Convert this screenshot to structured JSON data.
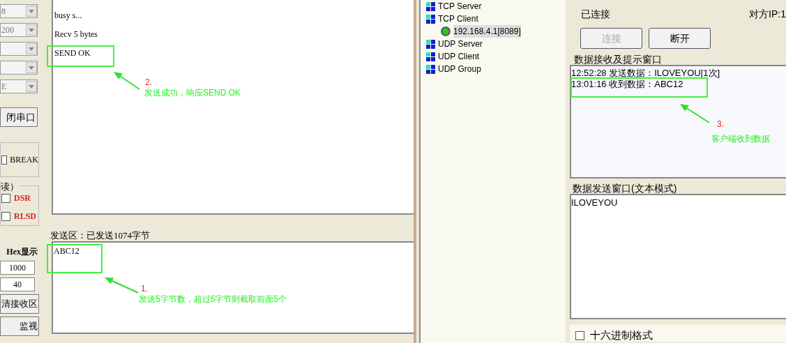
{
  "serial_tool": {
    "left_panel": {
      "combos": [
        {
          "kind": "dropdown",
          "value": "8"
        },
        {
          "kind": "dropdown",
          "value": "200"
        },
        {
          "kind": "dropdown"
        },
        {
          "kind": "dropdown"
        },
        {
          "kind": "dropdown",
          "value": "E"
        }
      ],
      "close_port_button": "闭串口",
      "break_checkbox": {
        "label": "BREAK",
        "checked": false
      },
      "signals_group": {
        "title": "读）",
        "items": [
          {
            "label": "DSR",
            "checked": false
          },
          {
            "label": "RLSD",
            "checked": false
          }
        ]
      },
      "hex_label": "Hex显示",
      "fields": [
        "1000",
        "40"
      ],
      "buttons": [
        "清接收区",
        "监视"
      ]
    },
    "receive_area": {
      "lines": [
        "busy s...",
        "Recv 5 bytes",
        "SEND OK"
      ]
    },
    "send_area": {
      "title": "发送区：已发送1074字节",
      "value": "ABC12"
    }
  },
  "network_tool": {
    "tree": [
      {
        "label": "TCP Server",
        "selected": false
      },
      {
        "label": "TCP Client",
        "selected": false,
        "children": [
          {
            "label": "192.168.4.1[8089]",
            "selected": true
          }
        ]
      },
      {
        "label": "UDP Server",
        "selected": false
      },
      {
        "label": "UDP Client",
        "selected": false
      },
      {
        "label": "UDP Group",
        "selected": false
      }
    ],
    "status": "已连接",
    "peer_ip": "对方IP:1",
    "buttons": [
      {
        "label": "连接",
        "disabled": true
      },
      {
        "label": "断开",
        "disabled": false
      }
    ],
    "receive_group": {
      "title": "数据接收及提示窗口",
      "lines": [
        "12:52:28 发送数据：ILOVEYOU[1次]",
        "13:01:16 收到数据：ABC12"
      ]
    },
    "send_group": {
      "title": "数据发送窗口(文本模式)",
      "value": "ILOVEYOU"
    },
    "hex_checkbox": {
      "label": "十六进制格式",
      "checked": false
    }
  },
  "annotations": [
    {
      "number": "2.",
      "text": "发送成功，响应SEND OK"
    },
    {
      "number": "1.",
      "text": "发送5字节数，超过5字节则截取前面5个"
    },
    {
      "number": "3.",
      "text": "客户端收到数据"
    }
  ]
}
